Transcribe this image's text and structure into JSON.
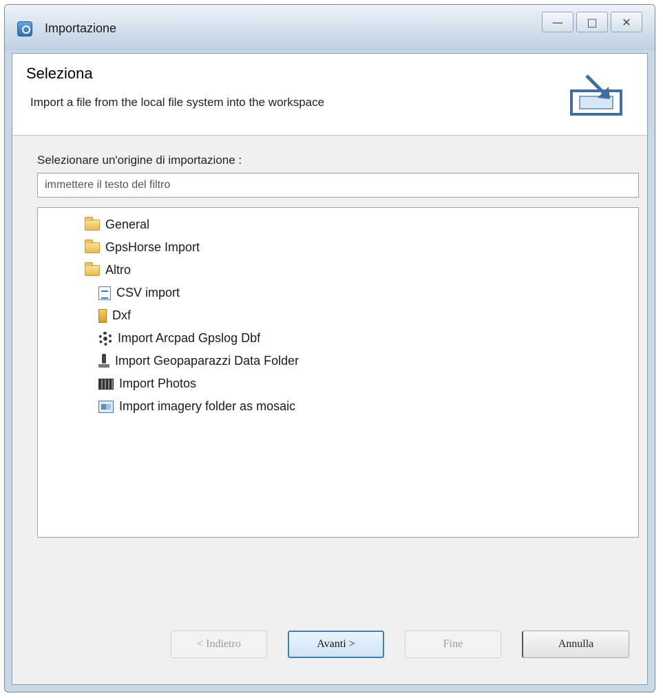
{
  "window": {
    "title": "Importazione",
    "controls": {
      "minimize": "—",
      "maximize": "□",
      "close": "✕"
    }
  },
  "header": {
    "title": "Seleziona",
    "description": "Import a file from the local file system into the workspace"
  },
  "selector": {
    "label": "Selezionare un'origine di importazione :",
    "filter_placeholder": "immettere il testo del filtro"
  },
  "tree": {
    "folders": [
      {
        "label": "General",
        "expanded": false
      },
      {
        "label": "GpsHorse Import",
        "expanded": false
      },
      {
        "label": "Altro",
        "expanded": true
      }
    ],
    "altro_children": [
      {
        "label": "CSV import",
        "icon": "csv-icon"
      },
      {
        "label": "Dxf",
        "icon": "dxf-icon"
      },
      {
        "label": "Import Arcpad Gpslog Dbf",
        "icon": "gear-icon"
      },
      {
        "label": "Import Geopaparazzi Data Folder",
        "icon": "gps-icon"
      },
      {
        "label": "Import Photos",
        "icon": "photo-icon"
      },
      {
        "label": "Import imagery folder as mosaic",
        "icon": "imagery-icon"
      }
    ]
  },
  "buttons": {
    "back": "< Indietro",
    "next": "Avanti >",
    "finish": "Fine",
    "cancel": "Annulla"
  }
}
